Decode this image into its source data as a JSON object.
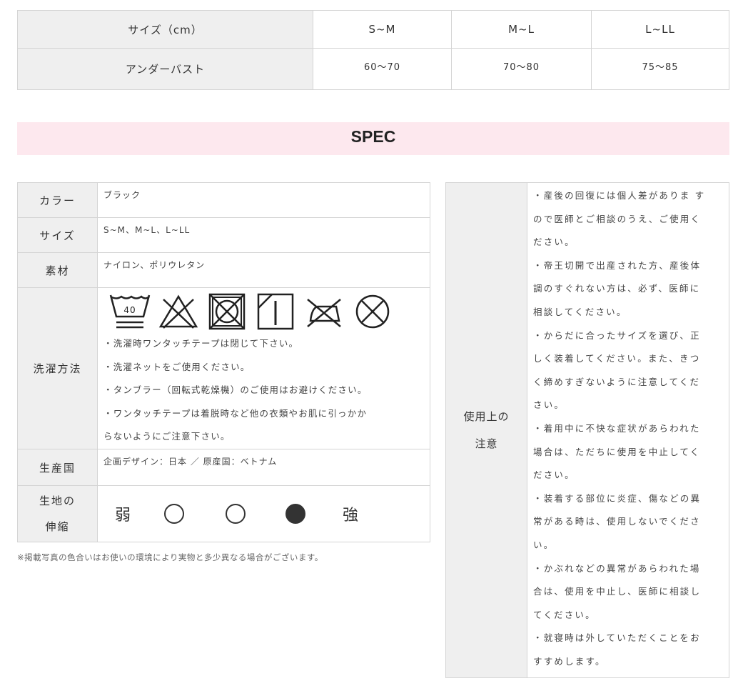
{
  "size_table": {
    "header": [
      "サイズ（cm）",
      "S~M",
      "M~L",
      "L~LL"
    ],
    "row": [
      "アンダーバスト",
      "60〜70",
      "70〜80",
      "75〜85"
    ]
  },
  "spec_title": "SPEC",
  "spec": {
    "color_label": "カラー",
    "color_value": "ブラック",
    "size_label": "サイズ",
    "size_value": "S~M、M~L、L~LL",
    "material_label": "素材",
    "material_value": "ナイロン、ポリウレタン",
    "wash_label": "洗濯方法",
    "wash_icons": [
      "wash-40-icon",
      "no-bleach-icon",
      "no-tumble-dry-icon",
      "line-dry-shade-icon",
      "no-iron-icon",
      "no-dry-clean-icon"
    ],
    "wash_icon_text": "40",
    "wash_lines": [
      "・洗濯時ワンタッチテープは閉じて下さい。",
      "・洗濯ネットをご使用ください。",
      "・タンブラー（回転式乾燥機）のご使用はお避けください。",
      "・ワンタッチテープは着脱時など他の衣類やお肌に引っかか",
      "らないようにご注意下さい。"
    ],
    "origin_label": "生産国",
    "origin_value": "企画デザイン：日本 ／ 原産国：ベトナム",
    "stretch_label_1": "生地の",
    "stretch_label_2": "伸縮",
    "stretch_weak": "弱",
    "stretch_strong": "強",
    "stretch_level": 3,
    "stretch_max": 3
  },
  "note": "※掲載写真の色合いはお使いの環境により実物と多少異なる場合がございます。",
  "caution": {
    "label_1": "使用上の",
    "label_2": "注意",
    "lines": [
      "・産後の回復には個人差がありま す",
      "ので医師とご相談のうえ、ご使用く",
      "ださい。",
      "・帝王切開で出産された方、産後体",
      "調のすぐれない方は、必ず、医師に",
      "相談してください。",
      "・からだに合ったサイズを選び、正",
      "しく装着してください。また、きつ",
      "く締めすぎないように注意してくだ",
      "さい。",
      "・着用中に不快な症状があらわれた",
      "場合は、ただちに使用を中止してく",
      "ださい。",
      "・装着する部位に炎症、傷などの異",
      "常がある時は、使用しないでくださ",
      "い。",
      "・かぶれなどの異常があらわれた場",
      "合は、使用を中止し、医師に相談し",
      "てください。",
      "・就寝時は外していただくことをお",
      "すすめします。"
    ]
  }
}
